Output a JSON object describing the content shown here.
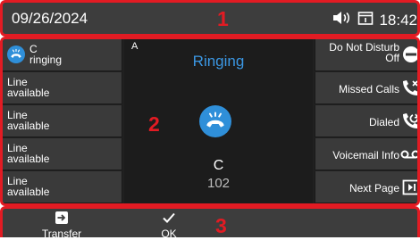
{
  "status_bar": {
    "date": "09/26/2024",
    "time": "18:42"
  },
  "markers": {
    "status": "1",
    "main": "2",
    "softkeys": "3"
  },
  "line_keys": [
    {
      "name": "C",
      "state": "ringing"
    },
    {
      "name": "Line",
      "state": "available"
    },
    {
      "name": "Line",
      "state": "available"
    },
    {
      "name": "Line",
      "state": "available"
    },
    {
      "name": "Line",
      "state": "available"
    }
  ],
  "call": {
    "line_letter": "A",
    "state": "Ringing",
    "caller_name": "C",
    "caller_number": "102"
  },
  "feature_keys": [
    {
      "line1": "Do Not Disturb",
      "line2": "Off",
      "icon": "dnd-icon"
    },
    {
      "label": "Missed Calls",
      "icon": "missed-call-icon"
    },
    {
      "label": "Dialed",
      "icon": "dialed-call-icon"
    },
    {
      "label": "Voicemail Info",
      "icon": "voicemail-icon"
    },
    {
      "label": "Next Page",
      "icon": "next-page-icon"
    }
  ],
  "softkeys": [
    {
      "label": "Transfer",
      "icon": "transfer-icon"
    },
    {
      "label": "OK",
      "icon": "check-icon"
    }
  ],
  "colors": {
    "highlight": "#e21b23",
    "accent": "#2f8fd9",
    "ringing_text": "#3b97e3"
  }
}
